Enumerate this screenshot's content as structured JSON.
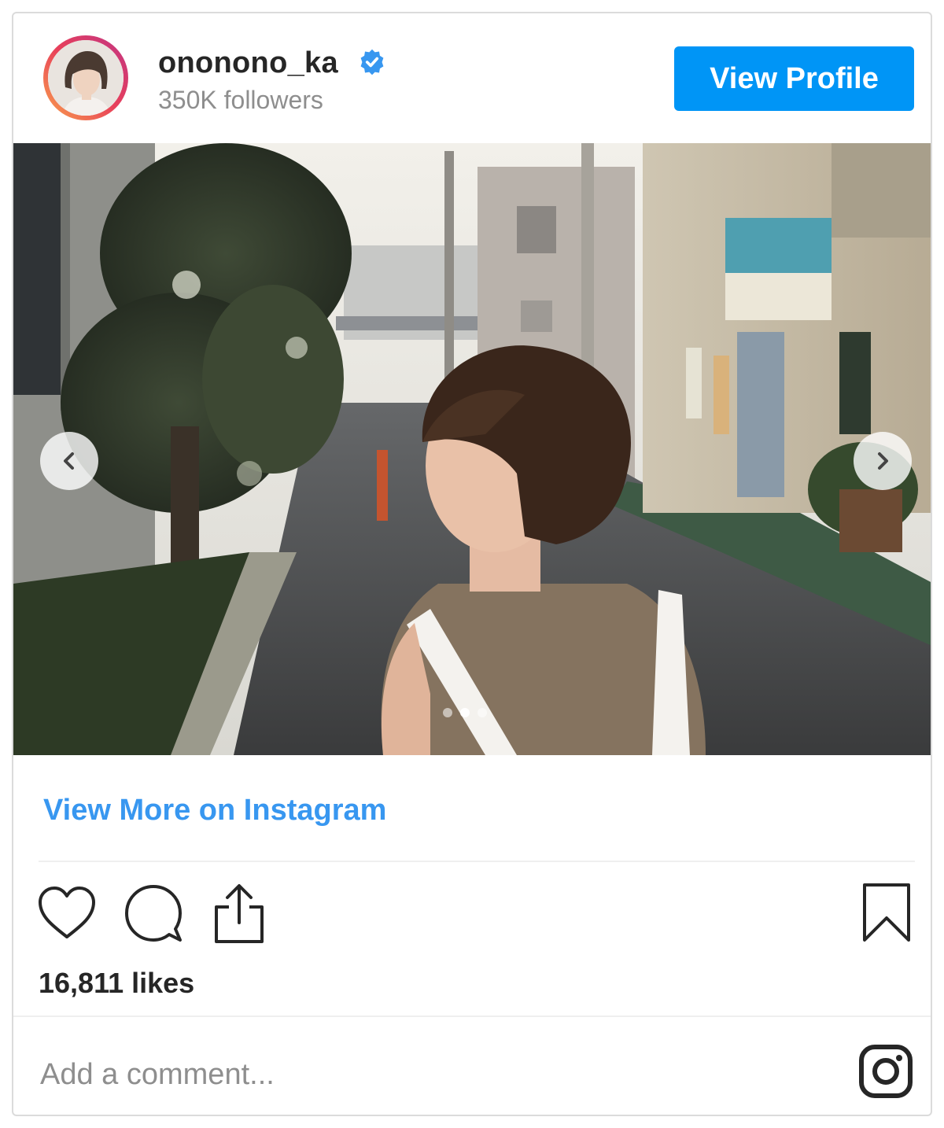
{
  "header": {
    "username": "ononono_ka",
    "verified_icon": "verified-badge-icon",
    "followers": "350K followers",
    "view_profile_label": "View Profile"
  },
  "post": {
    "carousel": {
      "slide_count": 3,
      "active_slide": 2,
      "prev_icon": "chevron-left-icon",
      "next_icon": "chevron-right-icon"
    },
    "view_more_label": "View More on Instagram",
    "likes": "16,811 likes",
    "comment_placeholder": "Add a comment...",
    "actions": [
      "heart-icon",
      "comment-icon",
      "share-icon",
      "bookmark-icon"
    ]
  },
  "colors": {
    "accent": "#0095f6",
    "link": "#3897f0",
    "text": "#262626",
    "muted": "#8e8e8e",
    "border": "#dbdbdb"
  }
}
